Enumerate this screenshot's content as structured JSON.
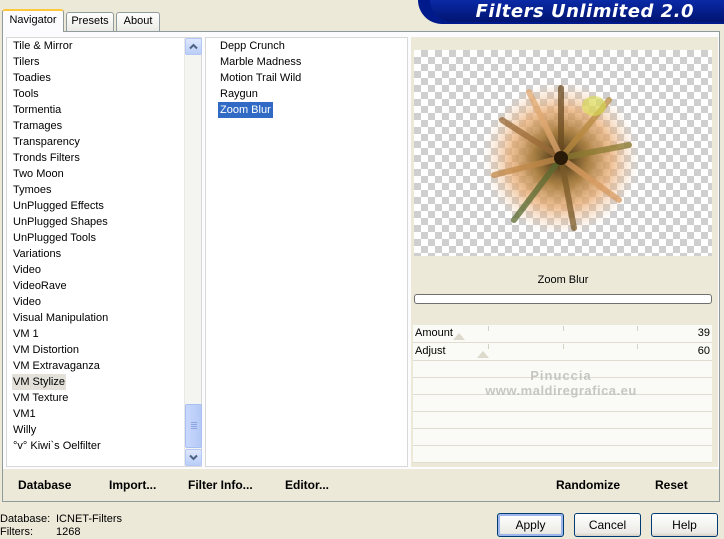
{
  "tabs": [
    {
      "label": "Navigator",
      "active": true
    },
    {
      "label": "Presets",
      "active": false
    },
    {
      "label": "About",
      "active": false
    }
  ],
  "banner": {
    "title": "Filters Unlimited 2.0"
  },
  "categories": [
    "Tile & Mirror",
    "Tilers",
    "Toadies",
    "Tools",
    "Tormentia",
    "Tramages",
    "Transparency",
    "Tronds Filters",
    "Two Moon",
    "Tymoes",
    "UnPlugged Effects",
    "UnPlugged Shapes",
    "UnPlugged Tools",
    "Variations",
    "Video",
    "VideoRave",
    "Video",
    "Visual Manipulation",
    "VM 1",
    "VM Distortion",
    "VM Extravaganza",
    "VM Stylize",
    "VM Texture",
    "VM1",
    "Willy",
    "°v° Kiwi`s Oelfilter"
  ],
  "category_selected": "VM Stylize",
  "filters": [
    "Depp Crunch",
    "Marble Madness",
    "Motion Trail Wild",
    "Raygun",
    "Zoom Blur"
  ],
  "filter_selected": "Zoom Blur",
  "preview": {
    "filter_name": "Zoom Blur"
  },
  "params": [
    {
      "label": "Amount",
      "value": "39"
    },
    {
      "label": "Adjust",
      "value": "60"
    }
  ],
  "watermark": {
    "line1": "Pinuccia",
    "line2": "www.maldiregrafica.eu"
  },
  "toolbar": {
    "database": "Database",
    "import": "Import...",
    "filter_info": "Filter Info...",
    "editor": "Editor...",
    "randomize": "Randomize",
    "reset": "Reset"
  },
  "status": {
    "database_label": "Database:",
    "database_value": "ICNET-Filters",
    "filters_label": "Filters:",
    "filters_value": "1268"
  },
  "buttons": {
    "apply": "Apply",
    "cancel": "Cancel",
    "help": "Help"
  },
  "colors": {
    "banner": "#001a8c",
    "selection": "#316ac5",
    "tab_highlight": "#ffc83c"
  },
  "icons": {
    "scroll_up": "chevron-up-icon",
    "scroll_down": "chevron-down-icon"
  }
}
